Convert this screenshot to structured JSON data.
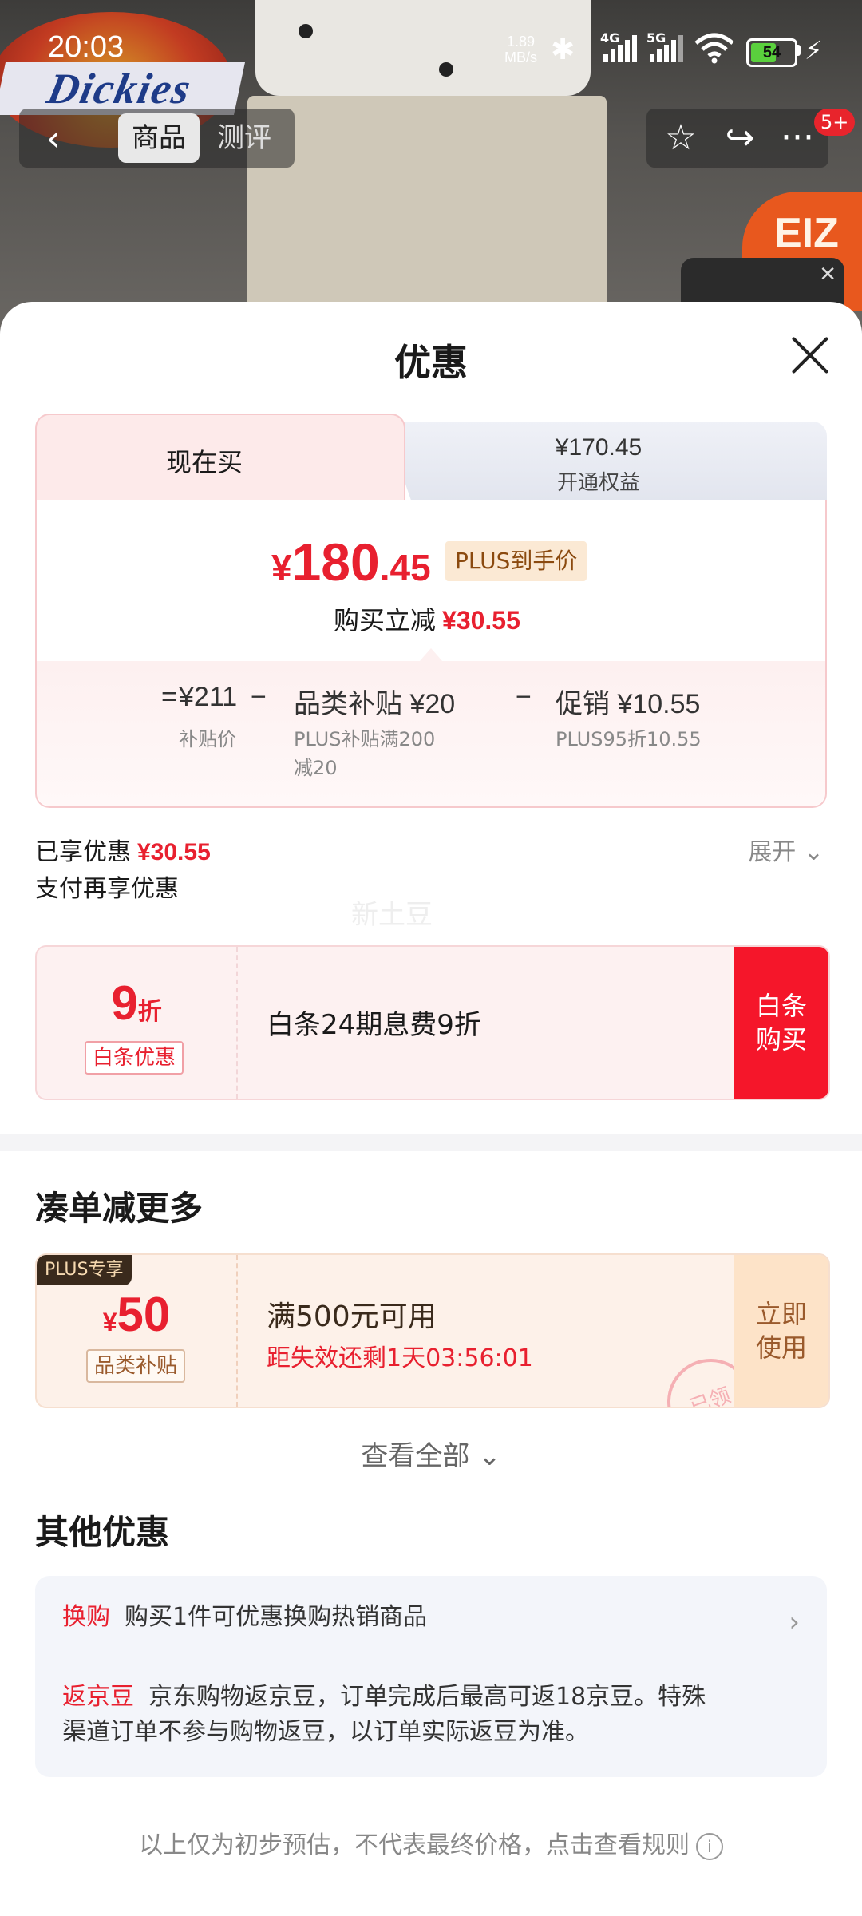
{
  "status_bar": {
    "time": "20:03",
    "net_speed_value": "1.89",
    "net_speed_unit": "MB/s",
    "network_4g": "4G",
    "network_5g": "5G",
    "battery": "54"
  },
  "background": {
    "brand_logo": "Dickies",
    "badge_text": "EIZ"
  },
  "nav": {
    "tab_product": "商品",
    "tab_review": "测评",
    "message_badge": "5+"
  },
  "sheet": {
    "title": "优惠",
    "tabs": {
      "now_label": "现在买",
      "plus_price": "¥170.45",
      "plus_label": "开通权益"
    },
    "price": {
      "currency": "¥",
      "integer": "180",
      "decimal": ".45",
      "plus_tag": "PLUS到手价",
      "reduce_label": "购买立减",
      "reduce_value": "¥30.55"
    },
    "calc": {
      "eq": "=",
      "base_value": "¥211",
      "base_sub": "补贴价",
      "minus1": "−",
      "subsidy_value": "品类补贴 ¥20",
      "subsidy_sub_line1": "PLUS补贴满200",
      "subsidy_sub_line2": "减20",
      "minus2": "−",
      "promo_value": "促销 ¥10.55",
      "promo_sub": "PLUS95折10.55"
    },
    "enjoyed_label": "已享优惠",
    "enjoyed_value": "¥30.55",
    "expand_label": "展开",
    "pay_more_label": "支付再享优惠",
    "watermark": "新土豆",
    "baitiao": {
      "rate_num": "9",
      "rate_unit": "折",
      "tag": "白条优惠",
      "desc": "白条24期息费9折",
      "btn_line1": "白条",
      "btn_line2": "购买"
    },
    "combine_title": "凑单减更多",
    "coupon": {
      "plus_only": "PLUS专享",
      "currency": "¥",
      "amount": "50",
      "tag": "品类补贴",
      "condition": "满500元可用",
      "expiry": "距失效还剩1天03:56:01",
      "btn_line1": "立即",
      "btn_line2": "使用",
      "stamp": "已领"
    },
    "view_all": "查看全部",
    "other_title": "其他优惠",
    "other": {
      "exchange_key": "换购",
      "exchange_text": "购买1件可优惠换购热销商品",
      "bean_key": "返京豆",
      "bean_text_line1": "京东购物返京豆，订单完成后最高可返18京豆。特殊",
      "bean_text_line2": "渠道订单不参与购物返豆，以订单实际返豆为准。"
    },
    "footer_note": "以上仅为初步预估，不代表最终价格，点击查看规则"
  },
  "colors": {
    "accent_red": "#e8202f",
    "baitiao_btn": "#f5162a",
    "coupon_btn": "#fde3c8"
  }
}
